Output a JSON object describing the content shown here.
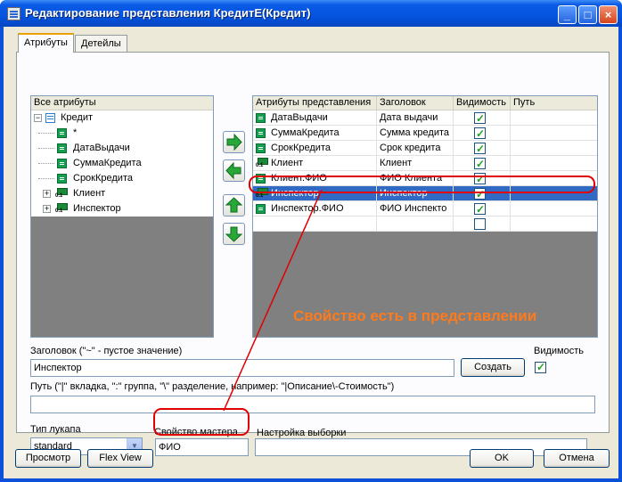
{
  "window": {
    "title": "Редактирование представления КредитЕ(Кредит)",
    "controls": {
      "minimize": "_",
      "maximize": "□",
      "close": "×"
    }
  },
  "tabs": [
    {
      "label": "Атрибуты",
      "active": true
    },
    {
      "label": "Детейлы",
      "active": false
    }
  ],
  "all_attributes": {
    "header": "Все атрибуты",
    "items": [
      {
        "label": "Кредит",
        "icon": "table-icon",
        "expander": "−"
      },
      {
        "label": "*",
        "icon": "field-icon"
      },
      {
        "label": "ДатаВыдачи",
        "icon": "field-icon"
      },
      {
        "label": "СуммаКредита",
        "icon": "field-icon"
      },
      {
        "label": "СрокКредита",
        "icon": "field-icon"
      },
      {
        "label": "Клиент",
        "icon": "link-icon",
        "expander": "+"
      },
      {
        "label": "Инспектор",
        "icon": "link-icon",
        "expander": "+"
      }
    ]
  },
  "view_attributes": {
    "columns": [
      "Атрибуты представления",
      "Заголовок",
      "Видимость",
      "Путь"
    ],
    "rows": [
      {
        "name": "ДатаВыдачи",
        "caption": "Дата выдачи",
        "visible": true,
        "path": "",
        "icon": "field-icon",
        "selected": false
      },
      {
        "name": "СуммаКредита",
        "caption": "Сумма кредита",
        "visible": true,
        "path": "",
        "icon": "field-icon",
        "selected": false
      },
      {
        "name": "СрокКредита",
        "caption": "Срок кредита",
        "visible": true,
        "path": "",
        "icon": "field-icon",
        "selected": false
      },
      {
        "name": "Клиент",
        "caption": "Клиент",
        "visible": true,
        "path": "",
        "icon": "link-icon",
        "selected": false
      },
      {
        "name": "Клиент.ФИО",
        "caption": "ФИО Клиента",
        "visible": true,
        "path": "",
        "icon": "field-icon",
        "selected": false
      },
      {
        "name": "Инспектор",
        "caption": "Инспектор",
        "visible": true,
        "path": "",
        "icon": "link-icon",
        "selected": true
      },
      {
        "name": "Инспектор.ФИО",
        "caption": "ФИО Инспекто",
        "visible": true,
        "path": "",
        "icon": "field-icon",
        "selected": false
      }
    ]
  },
  "annotation": "Свойство есть в представлении",
  "caption_field": {
    "label": "Заголовок (\"~\" - пустое значение)",
    "value": "Инспектор",
    "create_button": "Создать",
    "visibility_label": "Видимость",
    "visibility_checked": true
  },
  "path_field": {
    "label": "Путь (\"|\" вкладка, \":\" группа, \"\\\" разделение, например: \"|Описание\\-Стоимость\")",
    "value": ""
  },
  "lookup_type": {
    "label": "Тип лукапа",
    "value": "standard"
  },
  "master_property": {
    "label": "Свойство мастера",
    "value": "ФИО"
  },
  "selection_settings": {
    "label": "Настройка выборки",
    "value": ""
  },
  "footer": {
    "preview": "Просмотр",
    "flexview": "Flex View",
    "ok": "OK",
    "cancel": "Отмена"
  },
  "colors": {
    "title_bar": "#0554e0",
    "selection": "#316ac5",
    "annotation": "#ff7a1a",
    "highlight": "#e00000"
  }
}
